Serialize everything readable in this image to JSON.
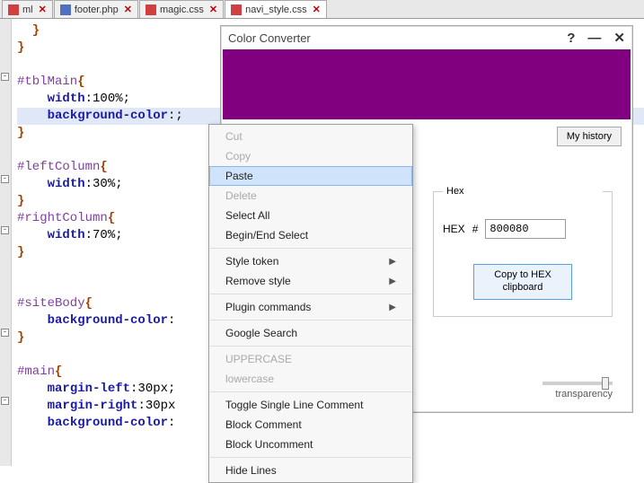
{
  "tabs": [
    {
      "label": "ml",
      "icon": "css",
      "close": "✕"
    },
    {
      "label": "footer.php",
      "icon": "php",
      "close": "✕"
    },
    {
      "label": "magic.css",
      "icon": "css",
      "close": "✕"
    },
    {
      "label": "navi_style.css",
      "icon": "css",
      "close": "✕",
      "active": true
    }
  ],
  "code": {
    "l1": "  }",
    "l2": "}",
    "l3": "",
    "sel1": "#tblMain",
    "l4b": "{",
    "p_width": "width",
    "v_100": ":100%;",
    "p_bg": "background-color",
    "v_bgsemi": ":;",
    "l7": "}",
    "l8": "",
    "sel2": "#leftColumn",
    "l9b": "{",
    "v_30": ":30%;",
    "l11": "}",
    "sel3": "#rightColumn",
    "l12b": "{",
    "v_70": ":70%;",
    "l14": "}",
    "l15": "",
    "l16": "",
    "sel4": "#siteBody",
    "l17b": "{",
    "v_bgcolon": ":",
    "l19": "}",
    "l20": "",
    "sel5": "#main",
    "l21b": "{",
    "p_ml": "margin-left",
    "v_30px": ":30px;",
    "p_mr": "margin-right",
    "v_30pxb": ":30px",
    "v_bgcolon2": ":"
  },
  "context_menu": {
    "cut": "Cut",
    "copy": "Copy",
    "paste": "Paste",
    "delete": "Delete",
    "select_all": "Select All",
    "begin_end": "Begin/End Select",
    "style_token": "Style token",
    "remove_style": "Remove style",
    "plugin_cmds": "Plugin commands",
    "google": "Google Search",
    "upper": "UPPERCASE",
    "lower": "lowercase",
    "toggle_cmt": "Toggle Single Line Comment",
    "block_cmt": "Block Comment",
    "block_uncmt": "Block Uncomment",
    "hide_lines": "Hide Lines"
  },
  "color_converter": {
    "title": "Color Converter",
    "swatch_hex": "#800080",
    "my_history": "My history",
    "hex_group": "Hex",
    "hex_label": "HEX",
    "hash": "#",
    "hex_value": "800080",
    "copy_btn_l1": "Copy to HEX",
    "copy_btn_l2": "clipboard",
    "transparency": "transparency",
    "help": "?",
    "min": "—",
    "close": "✕"
  }
}
